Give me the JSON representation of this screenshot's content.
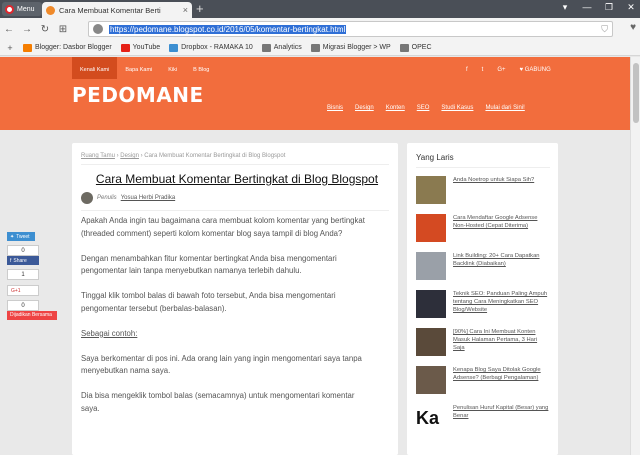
{
  "browser": {
    "menu_label": "Menu",
    "tab_title": "Cara Membuat Komentar Berti",
    "tab_close": "×",
    "new_tab": "+",
    "url": "https://pedomane.blogspot.co.id/2016/05/komentar-bertingkat.html",
    "bookmarks": [
      {
        "label": "Blogger: Dasbor Blogger",
        "icon": "blogger-icon",
        "color": "#f57d00"
      },
      {
        "label": "YouTube",
        "icon": "youtube-icon",
        "color": "#e62117"
      },
      {
        "label": "Dropbox - RAMAKA 10",
        "icon": "dropbox-icon",
        "color": "#3d8fd1"
      },
      {
        "label": "Analytics",
        "icon": "folder-icon",
        "color": "#777777"
      },
      {
        "label": "Migrasi Blogger > WP",
        "icon": "folder-icon",
        "color": "#777777"
      },
      {
        "label": "OPEC",
        "icon": "folder-icon",
        "color": "#777777"
      }
    ]
  },
  "site": {
    "accent_color": "#f26d3d",
    "topnav": [
      "Kenali Kami",
      "Bapa Kami",
      "Kiki",
      "B Blog"
    ],
    "social": [
      "f",
      "t",
      "G+",
      "♥ GABUNG"
    ],
    "logo": "PEDOMANE",
    "mainnav": [
      "Bisnis",
      "Design",
      "Konten",
      "SEO",
      "Studi Kasus",
      "Mulai dari Sini!"
    ]
  },
  "article": {
    "breadcrumb_home": "Ruang Tamu",
    "breadcrumb_cat": "Design",
    "breadcrumb_current": "Cara Membuat Komentar Bertingkat di Blog Blogspot",
    "title": "Cara Membuat Komentar Bertingkat di Blog Blogspot",
    "author_prefix": "Penulis",
    "author_name": "Yosua Herbi Pradika",
    "paragraphs": [
      "Apakah Anda ingin tau bagaimana cara membuat kolom komentar yang bertingkat (threaded comment) seperti kolom komentar blog saya tampil di blog Anda?",
      "Dengan menambahkan fitur komentar bertingkat Anda bisa mengomentari pengomentar lain tanpa menyebutkan namanya terlebih dahulu.",
      "Tinggal klik tombol balas di bawah foto tersebut, Anda bisa mengomentari pengomentar tersebut (berbalas-balasan)."
    ],
    "example_heading": "Sebagai contoh:",
    "paragraphs2": [
      "Saya berkomentar di pos ini. Ada orang lain yang ingin mengomentari saya tanpa menyebutkan nama saya.",
      "Dia bisa mengeklik tombol balas (semacamnya) untuk mengomentari komentar saya."
    ]
  },
  "share": {
    "tweet": "Tweet",
    "tweet_count": "0",
    "facebook": "Share",
    "fb_count": "1",
    "gplus": "G+1",
    "gplus_count": "0",
    "save": "Dijadikan Bersama"
  },
  "sidebar": {
    "title": "Yang Laris",
    "items": [
      {
        "text": "Anda Noetrop untuk Siapa Sih?",
        "thumb": "#8a7a50"
      },
      {
        "text": "Cara Mendaftar Google Adsense Non-Hosted (Cepat Diterima)",
        "thumb": "#d44a22"
      },
      {
        "text": "Link Building: 20+ Cara Dapatkan Backlink (Diabaikan)",
        "thumb": "#9aa0a8"
      },
      {
        "text": "Teknik SEO: Panduan Paling Ampuh tentang Cara Meningkatkan SEO Blog/Website",
        "thumb": "#2d2f3a"
      },
      {
        "text": "[90%] Cara Ini Membuat Konten Masuk Halaman Pertama, 3 Hari Saja",
        "thumb": "#5a4a3a"
      },
      {
        "text": "Kenapa Blog Saya Ditolak Google Adsense? (Berbagi Pengalaman)",
        "thumb": "#6b5a4a"
      },
      {
        "text": "Penulisan Huruf Kapital (Besar) yang Benar",
        "thumb": "#ffffff",
        "glyph": "Ka"
      }
    ]
  }
}
